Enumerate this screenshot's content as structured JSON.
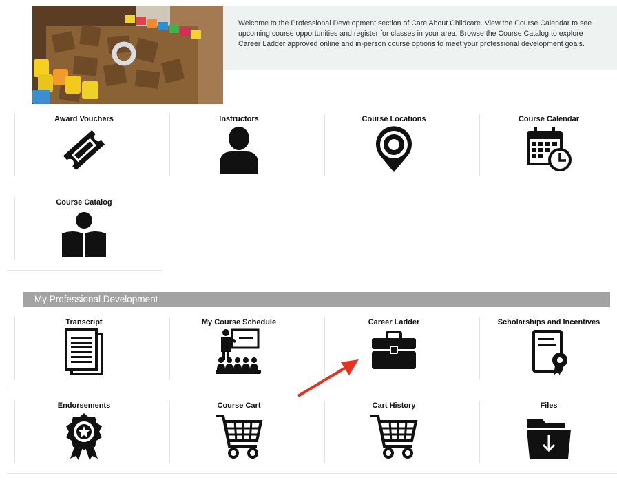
{
  "intro": {
    "text": "Welcome to the Professional Development section of Care About Childcare. View the Course Calendar to see upcoming course opportunities and register for classes in your area. Browse the Course Catalog to explore Career Ladder approved online and in-person course options to meet your professional development goals."
  },
  "resources": [
    {
      "label": "Award Vouchers",
      "icon": "ticket-icon"
    },
    {
      "label": "Instructors",
      "icon": "person-icon"
    },
    {
      "label": "Course Locations",
      "icon": "map-pin-icon"
    },
    {
      "label": "Course Calendar",
      "icon": "calendar-clock-icon"
    },
    {
      "label": "Course Catalog",
      "icon": "reader-book-icon"
    }
  ],
  "section": {
    "title": "My Professional Development"
  },
  "my_pd": [
    {
      "label": "Transcript",
      "icon": "documents-icon"
    },
    {
      "label": "My Course Schedule",
      "icon": "classroom-icon"
    },
    {
      "label": "Career Ladder",
      "icon": "briefcase-icon"
    },
    {
      "label": "Scholarships and Incentives",
      "icon": "certificate-icon"
    },
    {
      "label": "Endorsements",
      "icon": "award-ribbon-icon"
    },
    {
      "label": "Course Cart",
      "icon": "shopping-cart-icon"
    },
    {
      "label": "Cart History",
      "icon": "shopping-cart-icon"
    },
    {
      "label": "Files",
      "icon": "folder-download-icon"
    }
  ],
  "colors": {
    "section_bar": "#a3a3a3",
    "intro_bg": "#eef3f1",
    "annotation_arrow": "#e8321f"
  }
}
